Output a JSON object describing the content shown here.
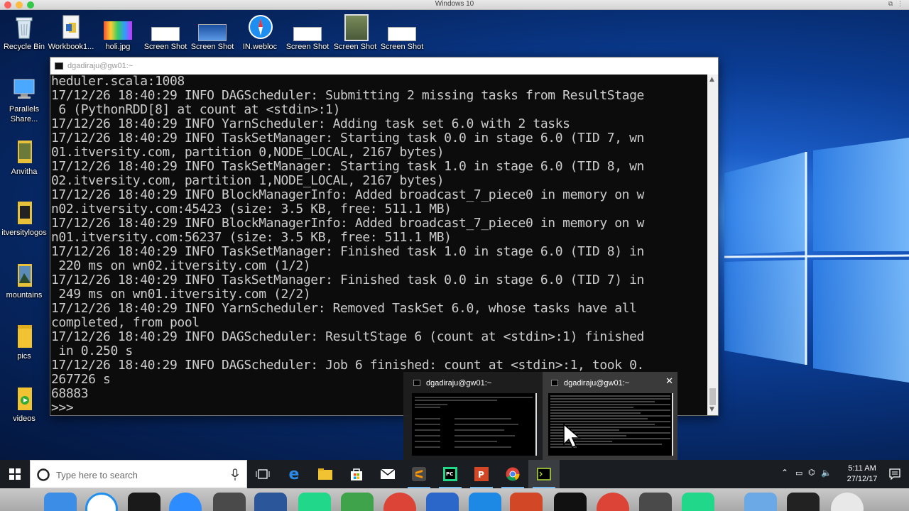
{
  "mac_window": {
    "title": "Windows 10"
  },
  "desktop_icons": {
    "recycle_bin": "Recycle Bin",
    "workbook": "Workbook1...",
    "holi": "holi.jpg",
    "screenshot_1": "Screen Shot",
    "screenshot_2": "Screen Shot",
    "in_webloc": "IN.webloc",
    "screenshot_3": "Screen Shot",
    "screenshot_4": "Screen Shot",
    "screenshot_5": "Screen Shot",
    "parallels_line1": "Parallels",
    "parallels_line2": "Share...",
    "anvitha": "Anvitha",
    "itversitylogos": "itversitylogos",
    "mountains": "mountains",
    "pics": "pics",
    "videos": "videos"
  },
  "terminal": {
    "title": "dgadiraju@gw01:~",
    "lines": [
      "heduler.scala:1008",
      "17/12/26 18:40:29 INFO DAGScheduler: Submitting 2 missing tasks from ResultStage",
      " 6 (PythonRDD[8] at count at <stdin>:1)",
      "17/12/26 18:40:29 INFO YarnScheduler: Adding task set 6.0 with 2 tasks",
      "17/12/26 18:40:29 INFO TaskSetManager: Starting task 0.0 in stage 6.0 (TID 7, wn",
      "01.itversity.com, partition 0,NODE_LOCAL, 2167 bytes)",
      "17/12/26 18:40:29 INFO TaskSetManager: Starting task 1.0 in stage 6.0 (TID 8, wn",
      "02.itversity.com, partition 1,NODE_LOCAL, 2167 bytes)",
      "17/12/26 18:40:29 INFO BlockManagerInfo: Added broadcast_7_piece0 in memory on w",
      "n02.itversity.com:45423 (size: 3.5 KB, free: 511.1 MB)",
      "17/12/26 18:40:29 INFO BlockManagerInfo: Added broadcast_7_piece0 in memory on w",
      "n01.itversity.com:56237 (size: 3.5 KB, free: 511.1 MB)",
      "17/12/26 18:40:29 INFO TaskSetManager: Finished task 1.0 in stage 6.0 (TID 8) in",
      " 220 ms on wn02.itversity.com (1/2)",
      "17/12/26 18:40:29 INFO TaskSetManager: Finished task 0.0 in stage 6.0 (TID 7) in",
      " 249 ms on wn01.itversity.com (2/2)",
      "17/12/26 18:40:29 INFO YarnScheduler: Removed TaskSet 6.0, whose tasks have all",
      "completed, from pool",
      "17/12/26 18:40:29 INFO DAGScheduler: ResultStage 6 (count at <stdin>:1) finished",
      " in 0.250 s",
      "17/12/26 18:40:29 INFO DAGScheduler: Job 6 finished: count at <stdin>:1, took 0.",
      "267726 s",
      "68883",
      ">>>"
    ]
  },
  "thumbnails": [
    {
      "title": "dgadiraju@gw01:~"
    },
    {
      "title": "dgadiraju@gw01:~"
    }
  ],
  "taskbar": {
    "search_placeholder": "Type here to search",
    "time": "5:11 AM",
    "date": "27/12/17"
  },
  "colors": {
    "terminal_bg": "#0c0c0c",
    "terminal_text": "#cccccc",
    "taskbar_bg": "#1a1d22",
    "desktop_accent": "#1a5bc5"
  }
}
